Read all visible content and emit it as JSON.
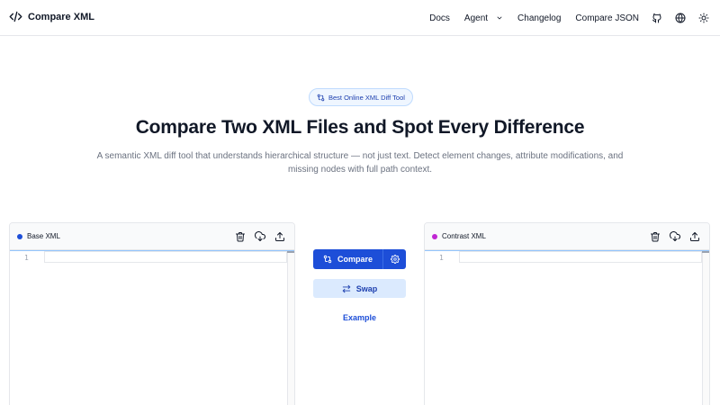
{
  "brand": {
    "name": "Compare XML",
    "icon": "code-brackets-icon"
  },
  "nav": {
    "links": [
      "Docs",
      "Agent",
      "Changelog",
      "Compare JSON"
    ],
    "icons": [
      "github-icon",
      "globe-icon",
      "sun-icon"
    ]
  },
  "hero": {
    "badge": "Best Online XML Diff Tool",
    "title": "Compare Two XML Files and Spot Every Difference",
    "subtitle": "A semantic XML diff tool that understands hierarchical structure — not just text. Detect element changes, attribute modifications, and missing nodes with full path context."
  },
  "panels": {
    "base": {
      "title": "Base XML",
      "dot_color": "#1d4ed8",
      "line_number": "1"
    },
    "contrast": {
      "title": "Contrast XML",
      "dot_color": "#c026d3",
      "line_number": "1"
    }
  },
  "controls": {
    "compare_label": "Compare",
    "swap_label": "Swap",
    "example_label": "Example"
  },
  "colors": {
    "accent": "#1d4ed8",
    "accent_soft": "#dbeafe"
  }
}
